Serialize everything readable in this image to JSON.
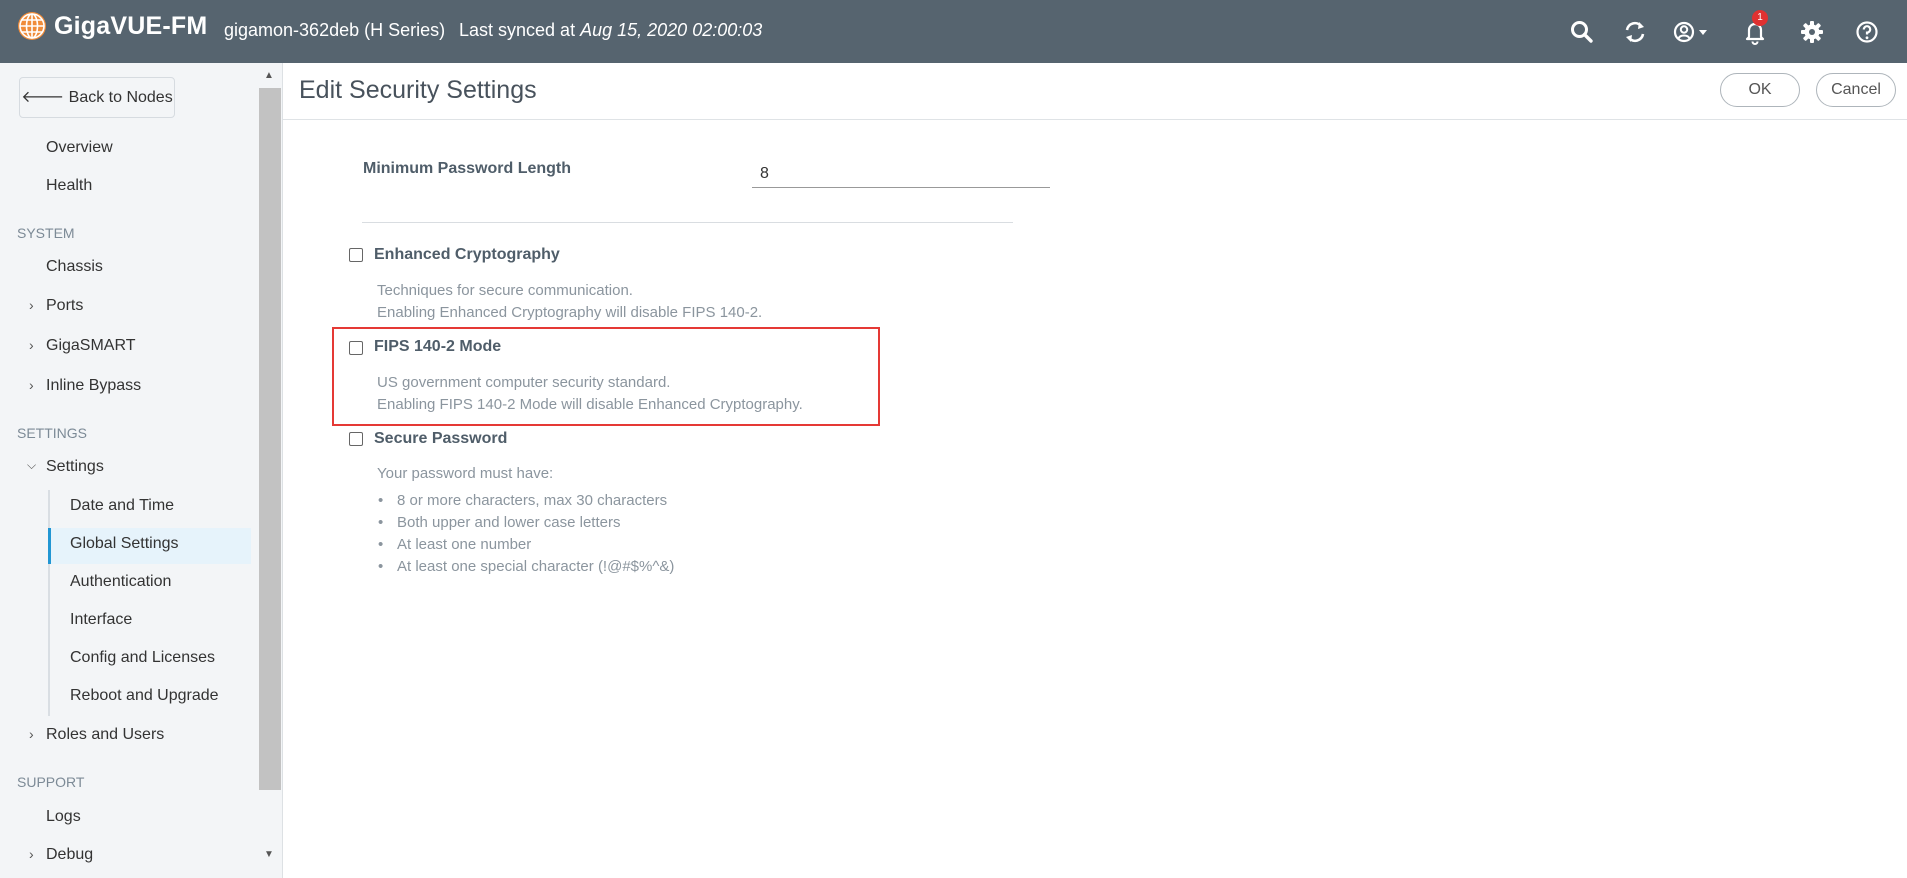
{
  "topbar": {
    "brand": "GigaVUE-FM",
    "device": "gigamon-362deb (H Series)",
    "sync_prefix": "Last synced at",
    "sync_time": "Aug 15, 2020 02:00:03",
    "notification_count": "1",
    "icons": [
      "globe-logo-icon",
      "search-icon",
      "refresh-icon",
      "user-icon",
      "bell-icon",
      "gear-icon",
      "help-icon"
    ]
  },
  "sidebar": {
    "back_label": "Back to Nodes",
    "top_items": [
      "Overview",
      "Health"
    ],
    "system_header": "SYSTEM",
    "system_items": [
      "Chassis",
      "Ports",
      "GigaSMART",
      "Inline Bypass"
    ],
    "settings_header": "SETTINGS",
    "settings_group": "Settings",
    "settings_sub": [
      "Date and Time",
      "Global Settings",
      "Authentication",
      "Interface",
      "Config and Licenses",
      "Reboot and Upgrade"
    ],
    "roles": "Roles and Users",
    "support_header": "SUPPORT",
    "support_items": [
      "Logs",
      "Debug"
    ],
    "active_item": "Global Settings"
  },
  "main": {
    "title": "Edit Security Settings",
    "ok_label": "OK",
    "cancel_label": "Cancel",
    "min_password_label": "Minimum Password Length",
    "min_password_value": "8",
    "options": [
      {
        "label": "Enhanced Cryptography",
        "checked": false,
        "desc1": "Techniques for secure communication.",
        "desc2": "Enabling Enhanced Cryptography will disable FIPS 140-2."
      },
      {
        "label": "FIPS 140-2 Mode",
        "checked": false,
        "desc1": "US government computer security standard.",
        "desc2": "Enabling FIPS 140-2 Mode will disable Enhanced Cryptography."
      },
      {
        "label": "Secure Password",
        "checked": false,
        "desc1": "Your password must have:",
        "rules": [
          "8 or more characters, max 30 characters",
          "Both upper and lower case letters",
          "At least one number",
          "At least one special character (!@#$%^&)"
        ]
      }
    ]
  },
  "colors": {
    "topbar": "#56646f",
    "sidebar": "#f3f5f7",
    "active_accent": "#2196d3",
    "highlight_box": "#e53935",
    "badge": "#e03131"
  }
}
